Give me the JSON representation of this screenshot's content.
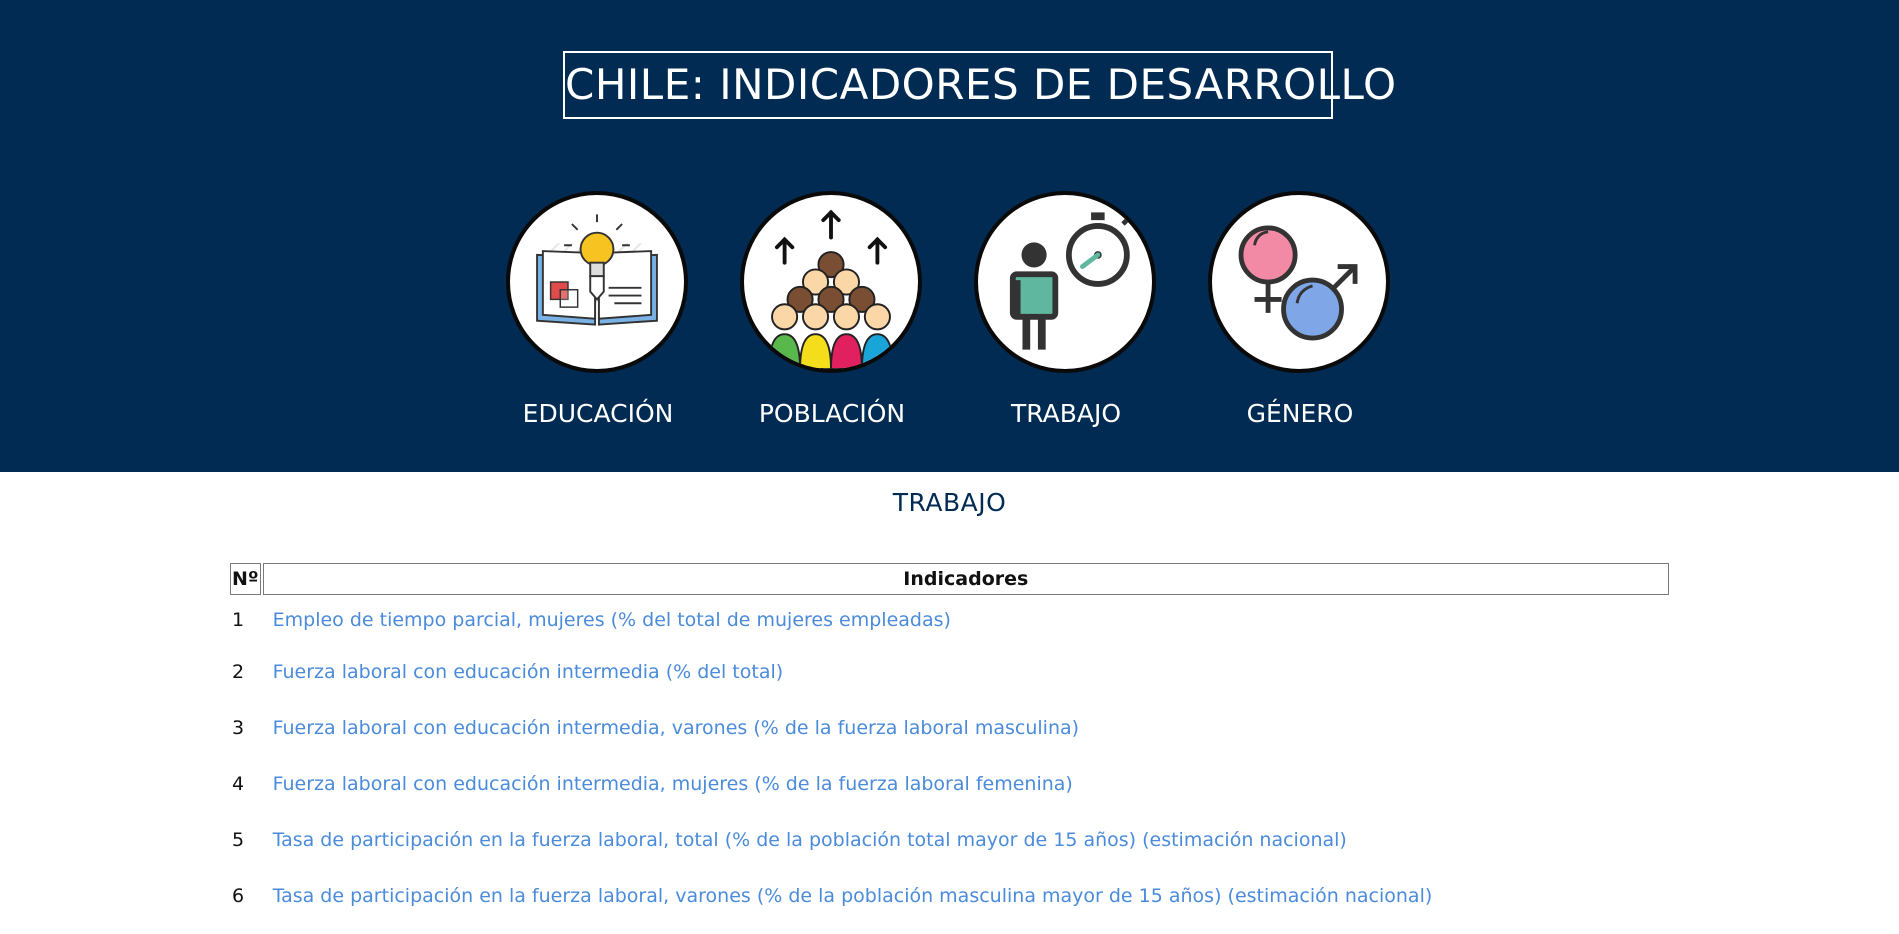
{
  "header": {
    "title": "CHILE: INDICADORES DE DESARROLLO"
  },
  "categories": [
    {
      "label": "EDUCACIÓN",
      "icon": "education-icon"
    },
    {
      "label": "POBLACIÓN",
      "icon": "population-icon"
    },
    {
      "label": "TRABAJO",
      "icon": "work-icon"
    },
    {
      "label": "GÉNERO",
      "icon": "gender-icon"
    }
  ],
  "section": {
    "title": "TRABAJO"
  },
  "table": {
    "headers": [
      "Nº",
      "Indicadores"
    ],
    "rows": [
      {
        "n": "1",
        "text": "Empleo de tiempo parcial, mujeres (% del total de mujeres empleadas)"
      },
      {
        "n": "2",
        "text": "Fuerza laboral con educación intermedia (% del total)"
      },
      {
        "n": "3",
        "text": "Fuerza laboral con educación intermedia, varones (% de la fuerza laboral masculina)"
      },
      {
        "n": "4",
        "text": "Fuerza laboral con educación intermedia, mujeres (% de la fuerza laboral femenina)"
      },
      {
        "n": "5",
        "text": "Tasa de participación en la fuerza laboral, total (% de la población total mayor de 15 años) (estimación nacional)"
      },
      {
        "n": "6",
        "text": "Tasa de participación en la fuerza laboral, varones (% de la población masculina mayor de 15 años) (estimación nacional)"
      }
    ]
  },
  "colors": {
    "header_bg": "#012b52",
    "link": "#4a8bdb",
    "section_title": "#012b52"
  }
}
